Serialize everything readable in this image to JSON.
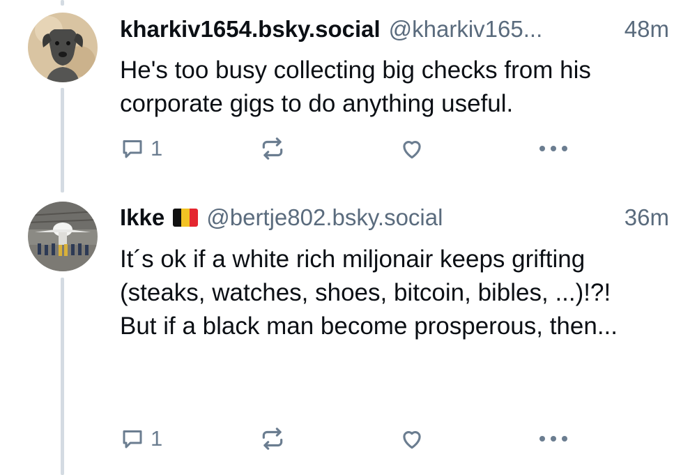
{
  "posts": [
    {
      "author": "kharkiv1654.bsky.social",
      "handle": "@kharkiv165...",
      "time": "48m",
      "text_lines": [
        "He's too busy collecting big checks from his corporate gigs to do anything useful."
      ],
      "reply_count": "1",
      "icons": [
        "reply-icon",
        "repost-icon",
        "like-icon",
        "more-icon"
      ],
      "avatar": "dog-avatar"
    },
    {
      "author": "Ikke",
      "flag": "belgium-flag",
      "flag_colors": [
        "#111111",
        "#f2c224",
        "#e4262f"
      ],
      "handle": "@bertje802.bsky.social",
      "time": "36m",
      "text_lines": [
        "It´s ok if a white rich miljonair keeps grifting (steaks, watches, shoes, bitcoin, bibles, ...)!?!",
        "But if a black man become prosperous, then..."
      ],
      "reply_count": "1",
      "icons": [
        "reply-icon",
        "repost-icon",
        "like-icon",
        "more-icon"
      ],
      "avatar": "hangar-avatar"
    }
  ],
  "colors": {
    "text": "#0b0f14",
    "muted": "#5a6b7d",
    "icon": "#6b7d90",
    "thread_line": "#d4dbe2"
  }
}
